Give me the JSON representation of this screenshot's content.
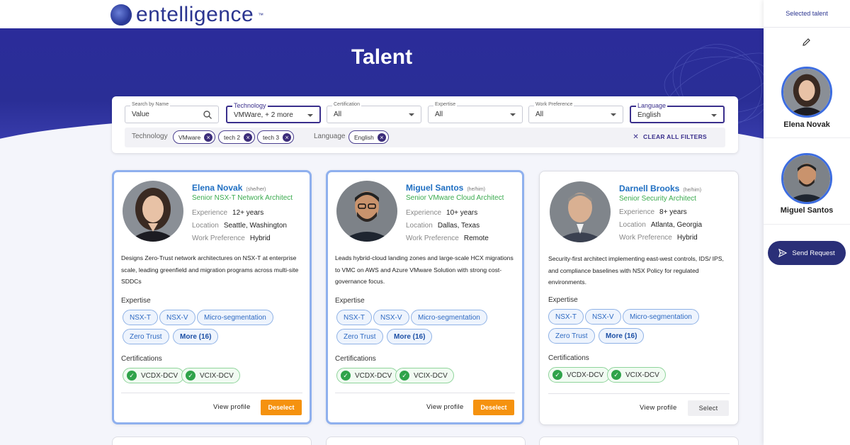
{
  "brand": {
    "name": "entelligence",
    "tm": "™"
  },
  "hero": {
    "title": "Talent"
  },
  "filters": {
    "search": {
      "label": "Search by Name",
      "value": "Value"
    },
    "technology": {
      "label": "Technology",
      "value": "VMWare, + 2 more"
    },
    "certification": {
      "label": "Certification",
      "value": "All"
    },
    "expertise": {
      "label": "Expertise",
      "value": "All"
    },
    "work_preference": {
      "label": "Work Preference",
      "value": "All"
    },
    "language": {
      "label": "Language",
      "value": "English"
    },
    "applied": {
      "technology_label": "Technology",
      "technology_chips": [
        "VMware",
        "tech 2",
        "tech 3"
      ],
      "language_label": "Language",
      "language_chips": [
        "English"
      ]
    },
    "clear_all": "CLEAR ALL FILTERS"
  },
  "labels": {
    "experience": "Experience",
    "location": "Location",
    "work_preference": "Work Preference",
    "expertise": "Expertise",
    "certifications": "Certifications",
    "view_profile": "View profile",
    "deselect": "Deselect",
    "select": "Select"
  },
  "cards": [
    {
      "name": "Elena Novak",
      "pronouns": "(she/her)",
      "role": "Senior NSX-T Network Architect",
      "experience": "12+ years",
      "location": "Seattle, Washington",
      "work_preference": "Hybrid",
      "description": "Designs Zero-Trust network architectures on NSX-T at enterprise scale, leading greenfield and migration programs across multi-site SDDCs",
      "expertise": [
        "NSX-T",
        "NSX-V",
        "Micro-segmentation",
        "Zero Trust"
      ],
      "more": "More (16)",
      "certifications": [
        "VCDX-DCV",
        "VCIX-DCV"
      ],
      "selected": true
    },
    {
      "name": "Miguel Santos",
      "pronouns": "(he/him)",
      "role": "Senior VMware Cloud Architect",
      "experience": "10+ years",
      "location": "Dallas, Texas",
      "work_preference": "Remote",
      "description": "Leads hybrid-cloud landing zones and large-scale HCX migrations to VMC on AWS and Azure VMware Solution with strong cost-governance focus.",
      "expertise": [
        "NSX-T",
        "NSX-V",
        "Micro-segmentation",
        "Zero Trust"
      ],
      "more": "More (16)",
      "certifications": [
        "VCDX-DCV",
        "VCIX-DCV"
      ],
      "selected": true
    },
    {
      "name": "Darnell Brooks",
      "pronouns": "(he/him)",
      "role": "Senior Security Architect",
      "experience": "8+ years",
      "location": "Atlanta, Georgia",
      "work_preference": "Hybrid",
      "description": "Security-first architect implementing east-west controls, IDS/ IPS, and compliance baselines with NSX Policy for regulated environments.",
      "expertise": [
        "NSX-T",
        "NSX-V",
        "Micro-segmentation",
        "Zero Trust"
      ],
      "more": "More (16)",
      "certifications": [
        "VCDX-DCV",
        "VCIX-DCV"
      ],
      "selected": false
    }
  ],
  "sidebar": {
    "title": "Selected talent",
    "selected": [
      "Elena Novak",
      "Miguel Santos"
    ],
    "send_button": "Send Request"
  },
  "colors": {
    "brand_navy": "#2b3590",
    "link_blue": "#1f6fc2",
    "role_green": "#3aaa4e",
    "deselect_orange": "#f5920f",
    "send_button": "#2a2f78"
  }
}
